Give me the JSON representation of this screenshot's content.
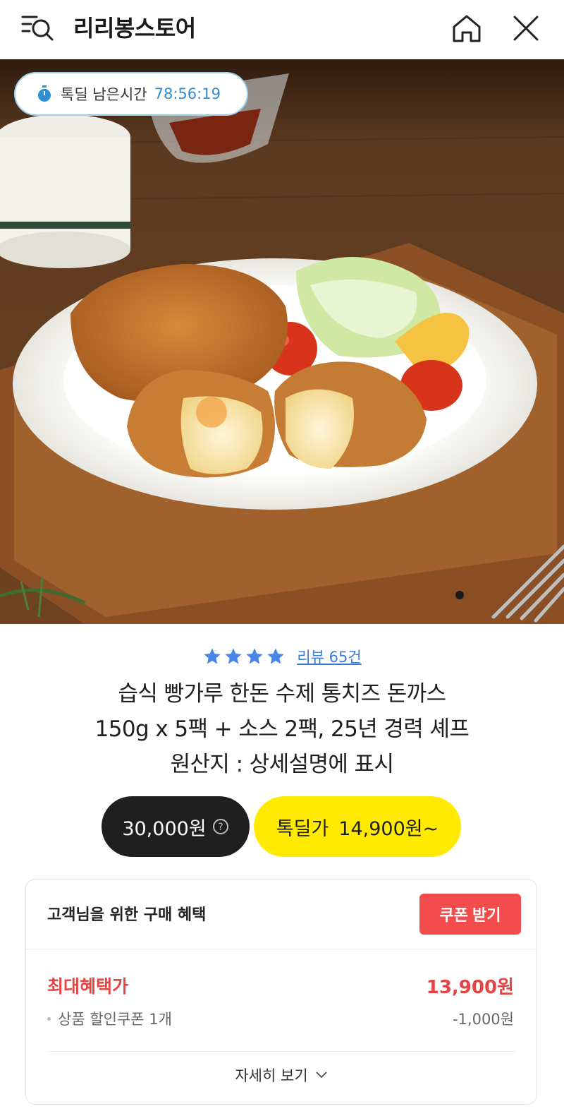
{
  "header": {
    "title": "리리봉스토어",
    "icons": [
      "search-menu-icon",
      "home-icon",
      "close-icon"
    ]
  },
  "hero": {
    "timer_label": "톡딜 남은시간",
    "timer_value": "78:56:19",
    "timer_icon": "stopwatch-icon",
    "image_alt": "cheese-pork-cutlet-plate"
  },
  "rating": {
    "stars": 4,
    "review_text": "리뷰 65건",
    "star_color": "#4a86e8"
  },
  "product": {
    "title_line1": "습식 빵가루 한돈 수제 통치즈 돈까스",
    "title_line2": "150g x 5팩 + 소스 2팩, 25년 경력 셰프",
    "title_line3": "원산지 : 상세설명에 표시"
  },
  "price": {
    "original": "30,000원",
    "deal_label": "톡딜가",
    "deal_value": "14,900원~",
    "deal_color": "#ffea00"
  },
  "benefit": {
    "title": "고객님을 위한 구매 혜택",
    "coupon_button": "쿠폰 받기",
    "max_label": "최대혜택가",
    "max_value": "13,900원",
    "coupon_item": "상품 할인쿠폰 1개",
    "coupon_discount": "-1,000원",
    "detail_button": "자세히 보기",
    "accent_color": "#e64545"
  }
}
